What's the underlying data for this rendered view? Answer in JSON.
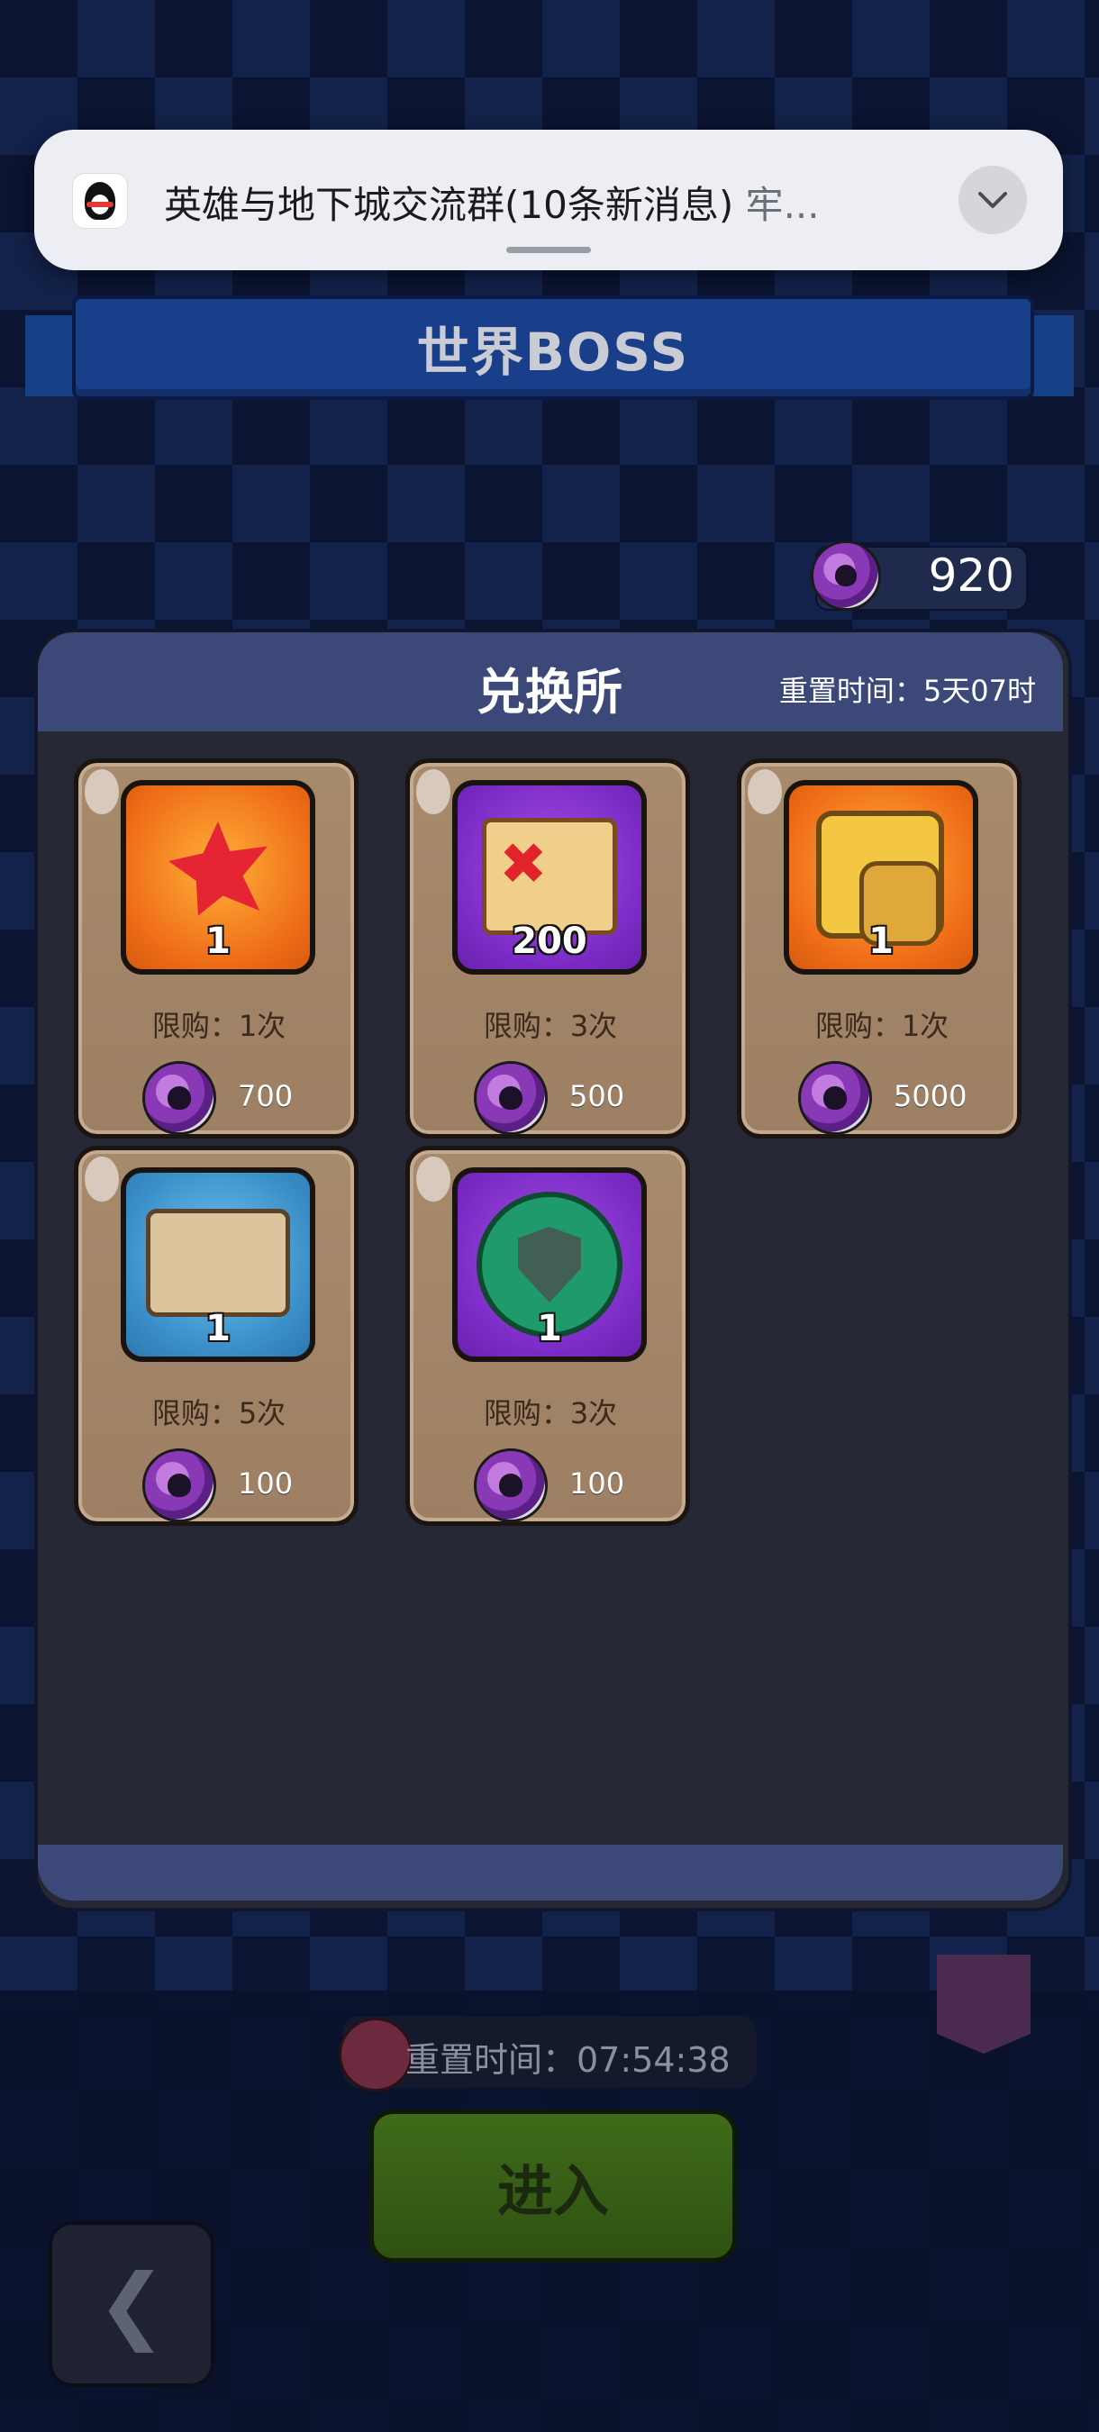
{
  "page_title": "世界BOSS",
  "notification": {
    "title": "英雄与地下城交流群(10条新消息)",
    "preview": "牢..."
  },
  "currency": {
    "amount": "920"
  },
  "shop": {
    "title": "兑换所",
    "reset_time": "重置时间：5天07时",
    "items": [
      {
        "qty": "1",
        "limit": "限购：1次",
        "price": "700"
      },
      {
        "qty": "200",
        "limit": "限购：3次",
        "price": "500"
      },
      {
        "qty": "1",
        "limit": "限购：1次",
        "price": "5000"
      },
      {
        "qty": "1",
        "limit": "限购：5次",
        "price": "100"
      },
      {
        "qty": "1",
        "limit": "限购：3次",
        "price": "100"
      }
    ]
  },
  "boss": {
    "reset_time": "重置时间：07:54:38",
    "enter_label": "进入"
  },
  "icons": {
    "back": "chevron-left-icon",
    "coin": "skull-coin-icon",
    "chevron": "chevron-down-icon"
  }
}
